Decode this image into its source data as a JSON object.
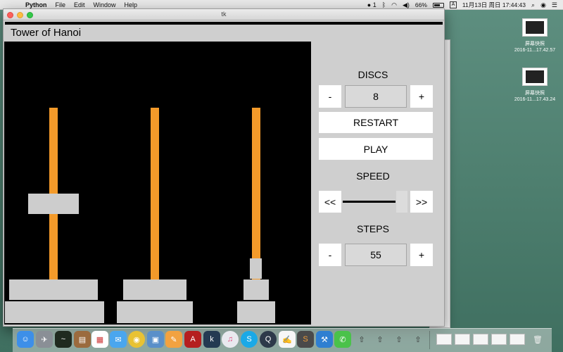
{
  "menubar": {
    "app": "Python",
    "items": [
      "File",
      "Edit",
      "Window",
      "Help"
    ],
    "wechat_count": "1",
    "battery": "66%",
    "input_method": "A",
    "datetime": "11月13日 周日  17:44:43"
  },
  "window": {
    "title": "tk",
    "app_title": "Tower of Hanoi"
  },
  "controls": {
    "discs_label": "DISCS",
    "discs_minus": "-",
    "discs_value": "8",
    "discs_plus": "+",
    "restart": "RESTART",
    "play": "PLAY",
    "speed_label": "SPEED",
    "speed_slower": "<<",
    "speed_faster": ">>",
    "speed_level": 0.95,
    "steps_label": "STEPS",
    "steps_minus": "-",
    "steps_value": "55",
    "steps_plus": "+"
  },
  "desktop": {
    "icons": [
      {
        "name": "屏幕快照",
        "sub": "2016-11...17.42.57"
      },
      {
        "name": "屏幕快照",
        "sub": "2016-11...17.43.24"
      }
    ]
  },
  "colors": {
    "peg": "#f39a2a",
    "disc": "#cdcdcd",
    "canvas": "#000000",
    "panel": "#cfcfcf"
  },
  "icons": {
    "apple": "apple-icon",
    "wifi": "wifi-icon",
    "volume": "volume-icon",
    "search": "search-icon",
    "list": "list-icon"
  }
}
